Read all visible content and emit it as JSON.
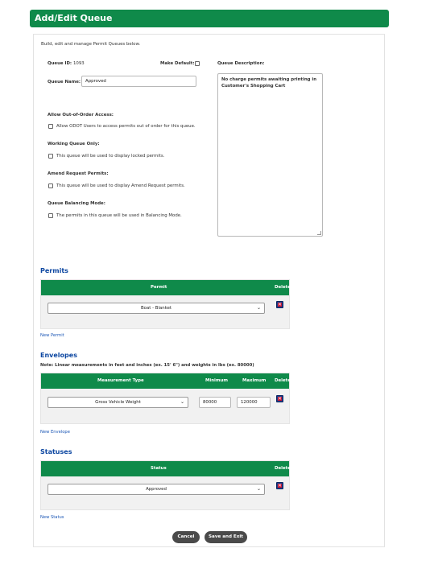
{
  "header": {
    "title": "Add/Edit Queue"
  },
  "intro": "Build, edit and manage Permit Queues below.",
  "queue": {
    "id_label": "Queue ID:",
    "id_value": "1093",
    "make_default_label": "Make Default:",
    "name_label": "Queue Name:",
    "name_value": "Approved",
    "description_label": "Queue Description:",
    "description_value": "No charge permits awaiting printing in Customer's Shopping Cart"
  },
  "options": [
    {
      "heading": "Allow Out-of-Order Access:",
      "checkbox_label": "Allow ODOT Users to access permits out of order for this queue."
    },
    {
      "heading": "Working Queue Only:",
      "checkbox_label": "This queue will be used to display locked permits."
    },
    {
      "heading": "Amend Request Permits:",
      "checkbox_label": "This queue will be used to display Amend Request permits."
    },
    {
      "heading": "Queue Balancing Mode:",
      "checkbox_label": "The permits in this queue will be used in Balancing Mode."
    }
  ],
  "permits": {
    "title": "Permits",
    "col_permit": "Permit",
    "col_delete": "Delete",
    "selected": "Boat - Blanket",
    "new_link": "New Permit"
  },
  "envelopes": {
    "title": "Envelopes",
    "note": "Note: Linear measurements in feet and inches (ex. 15' 6\") and weights in lbs (ex. 80000)",
    "col_type": "Measurement Type",
    "col_min": "Minimum",
    "col_max": "Maximum",
    "col_delete": "Delete",
    "selected": "Gross Vehicle Weight",
    "min_value": "80000",
    "max_value": "120000",
    "new_link": "New Envelope"
  },
  "statuses": {
    "title": "Statuses",
    "col_status": "Status",
    "col_delete": "Delete",
    "selected": "Approved",
    "new_link": "New Status"
  },
  "buttons": {
    "cancel": "Cancel",
    "save_exit": "Save and Exit"
  },
  "colors": {
    "header_green": "#0f8a4a",
    "section_blue": "#0d47a1",
    "link_blue": "#1a56b5"
  },
  "icons": {
    "delete": "delete-icon",
    "dropdown": "chevron-down-icon"
  }
}
